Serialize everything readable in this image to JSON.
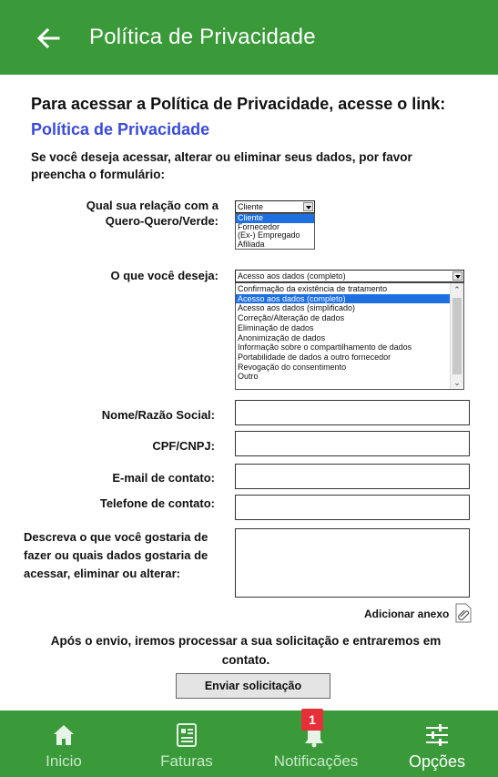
{
  "appbar": {
    "title": "Política de Privacidade"
  },
  "headline": {
    "text": "Para acessar a Política de Privacidade, acesse o link:",
    "link": "Política de Privacidade"
  },
  "intro": "Se você deseja acessar, alterar ou eliminar seus dados, por favor preencha o formulário:",
  "relation": {
    "label": "Qual sua relação com a Quero-Quero/Verde:",
    "selected": "Cliente",
    "options": [
      "Cliente",
      "Fornecedor",
      "(Ex-) Empregado",
      "Afiliada"
    ],
    "highlighted_index": 0
  },
  "request": {
    "label": "O que você deseja:",
    "selected": "Acesso aos dados (completo)",
    "options": [
      "Confirmação da existência de tratamento",
      "Acesso aos dados (completo)",
      "Acesso aos dados (simplificado)",
      "Correção/Alteração de dados",
      "Eliminação de dados",
      "Anonimização de dados",
      "Informação sobre o compartilhamento de dados",
      "Portabilidade de dados a outro fornecedor",
      "Revogação do consentimento",
      "Outro"
    ],
    "highlighted_index": 1
  },
  "fields": {
    "name_label": "Nome/Razão Social:",
    "cpf_label": "CPF/CNPJ:",
    "email_label": "E-mail de contato:",
    "phone_label": "Telefone de contato:",
    "description_label": "Descreva o que você gostaria de fazer ou quais dados gostaria de acessar, eliminar ou alterar:"
  },
  "attach_label": "Adicionar anexo",
  "after_submit_text": "Após o envio, iremos processar a sua solicitação e entraremos em contato.",
  "submit_label": "Enviar solicitação",
  "bottom_nav": {
    "items": [
      {
        "label": "Inicio",
        "icon": "home-icon"
      },
      {
        "label": "Faturas",
        "icon": "invoice-icon"
      },
      {
        "label": "Notificações",
        "icon": "bell-icon"
      },
      {
        "label": "Opções",
        "icon": "sliders-icon"
      }
    ],
    "badge": "1",
    "active_index": 3
  },
  "colors": {
    "brand_green": "#3a9a3a",
    "link_blue": "#3b4bd8",
    "highlight_blue": "#1e6fe0",
    "badge_red": "#e5303a"
  }
}
